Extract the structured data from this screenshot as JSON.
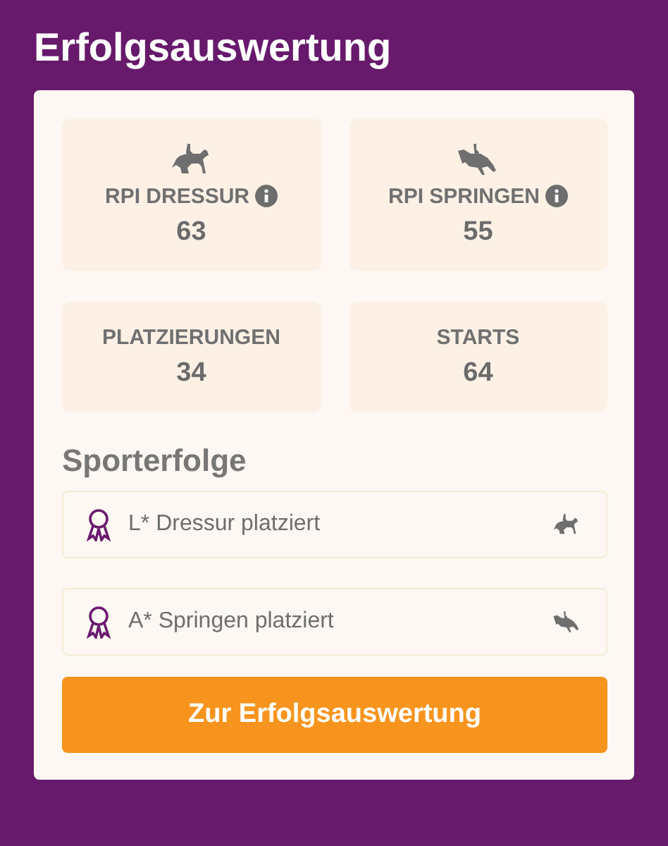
{
  "title": "Erfolgsauswertung",
  "stats": [
    {
      "kind": "dressage",
      "label": "RPI DRESSUR",
      "info": true,
      "value": "63"
    },
    {
      "kind": "jumping",
      "label": "RPI SPRINGEN",
      "info": true,
      "value": "55"
    },
    {
      "kind": "plain",
      "label": "PLATZIERUNGEN",
      "info": false,
      "value": "34"
    },
    {
      "kind": "plain",
      "label": "STARTS",
      "info": false,
      "value": "64"
    }
  ],
  "section_title": "Sporterfolge",
  "achievements": [
    {
      "text": "L* Dressur platziert",
      "kind": "dressage"
    },
    {
      "text": "A* Springen platziert",
      "kind": "jumping"
    }
  ],
  "button": "Zur Erfolgsauswertung"
}
